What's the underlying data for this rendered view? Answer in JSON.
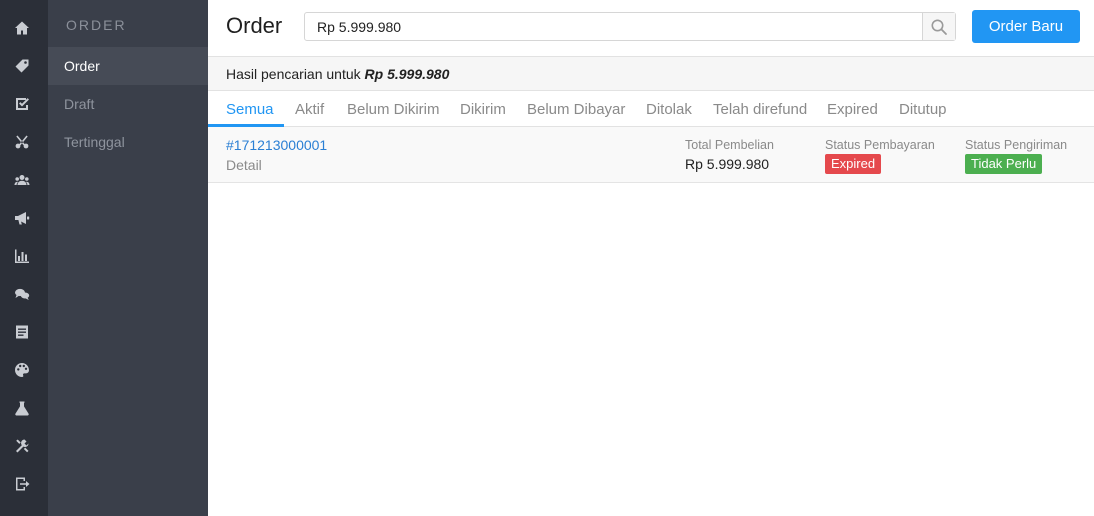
{
  "icon_bar": {
    "icons": [
      "home-icon",
      "tag-icon",
      "checkbox-icon",
      "scissors-icon",
      "users-icon",
      "megaphone-icon",
      "bar-chart-icon",
      "chat-icon",
      "document-icon",
      "palette-icon",
      "flask-icon",
      "tools-icon",
      "logout-icon"
    ]
  },
  "subnav": {
    "heading": "ORDER",
    "items": [
      {
        "label": "Order",
        "active": true
      },
      {
        "label": "Draft",
        "active": false
      },
      {
        "label": "Tertinggal",
        "active": false
      }
    ]
  },
  "header": {
    "title": "Order",
    "search_value": "Rp 5.999.980",
    "new_order_label": "Order Baru"
  },
  "results": {
    "prefix": "Hasil pencarian untuk",
    "query": "Rp 5.999.980"
  },
  "tabs": [
    {
      "label": "Semua",
      "active": true
    },
    {
      "label": "Aktif"
    },
    {
      "label": "Belum Dikirim"
    },
    {
      "label": "Dikirim"
    },
    {
      "label": "Belum Dibayar"
    },
    {
      "label": "Ditolak"
    },
    {
      "label": "Telah direfund"
    },
    {
      "label": "Expired"
    },
    {
      "label": "Ditutup"
    }
  ],
  "orders": [
    {
      "id": "#171213000001",
      "detail_label": "Detail",
      "total_label": "Total Pembelian",
      "total_value": "Rp 5.999.980",
      "payment_label": "Status Pembayaran",
      "payment_status": "Expired",
      "shipping_label": "Status Pengiriman",
      "shipping_status": "Tidak Perlu"
    }
  ],
  "colors": {
    "accent": "#2196f3",
    "sidebar_dark": "#2b2f38",
    "subnav": "#3a3f4a",
    "status_expired": "#e5494d",
    "status_ok": "#4caf50"
  }
}
